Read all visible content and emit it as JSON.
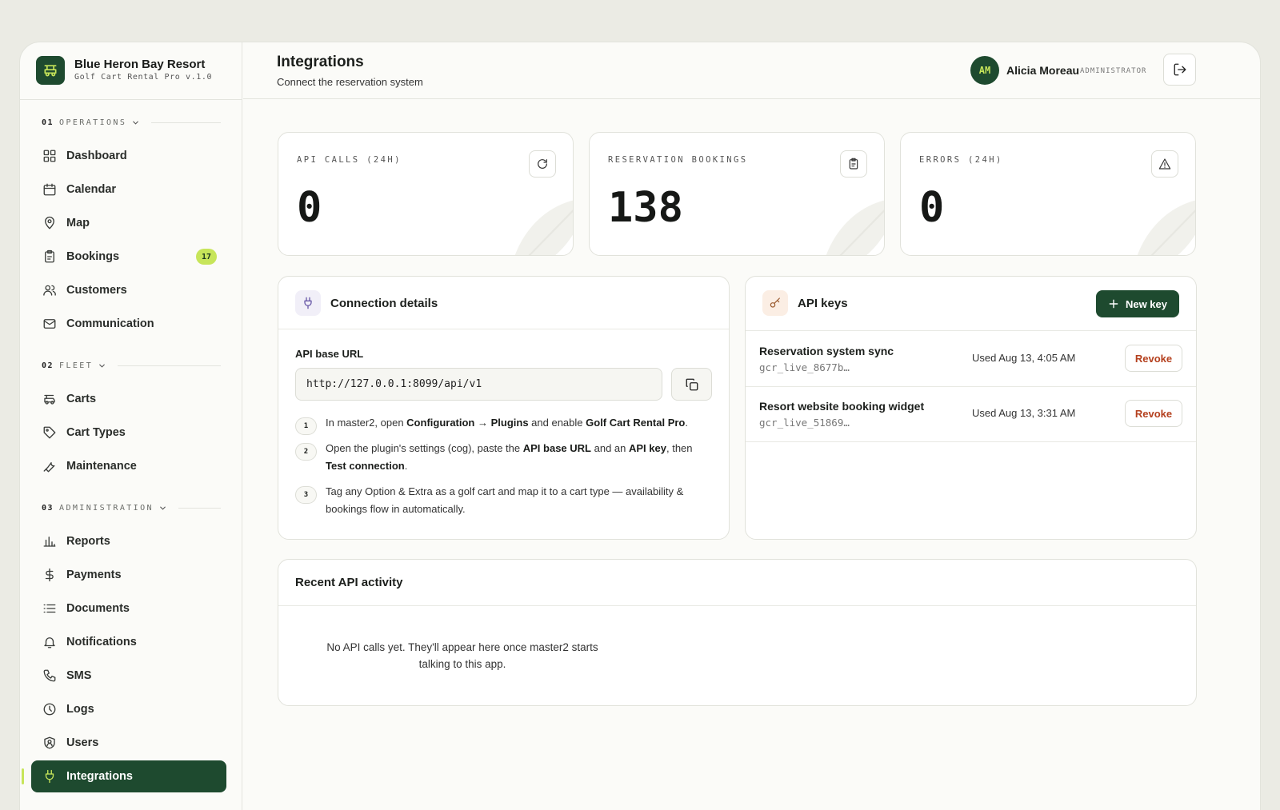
{
  "brand": {
    "name": "Blue Heron Bay Resort",
    "subtitle": "Golf Cart Rental Pro v.1.0"
  },
  "sidebar": {
    "sections": [
      {
        "num": "01",
        "label": "OPERATIONS"
      },
      {
        "num": "02",
        "label": "FLEET"
      },
      {
        "num": "03",
        "label": "ADMINISTRATION"
      }
    ],
    "items": [
      {
        "label": "Dashboard",
        "icon": "dashboard-icon"
      },
      {
        "label": "Calendar",
        "icon": "calendar-icon"
      },
      {
        "label": "Map",
        "icon": "map-pin-icon"
      },
      {
        "label": "Bookings",
        "icon": "clipboard-icon",
        "badge": "17"
      },
      {
        "label": "Customers",
        "icon": "users-icon"
      },
      {
        "label": "Communication",
        "icon": "mail-icon"
      },
      {
        "label": "Carts",
        "icon": "golf-cart-icon"
      },
      {
        "label": "Cart Types",
        "icon": "tag-icon"
      },
      {
        "label": "Maintenance",
        "icon": "wrench-icon"
      },
      {
        "label": "Reports",
        "icon": "bar-chart-icon"
      },
      {
        "label": "Payments",
        "icon": "dollar-icon"
      },
      {
        "label": "Documents",
        "icon": "list-icon"
      },
      {
        "label": "Notifications",
        "icon": "bell-icon"
      },
      {
        "label": "SMS",
        "icon": "phone-icon"
      },
      {
        "label": "Logs",
        "icon": "clock-icon"
      },
      {
        "label": "Users",
        "icon": "shield-user-icon"
      },
      {
        "label": "Integrations",
        "icon": "plug-icon",
        "active": true
      }
    ]
  },
  "header": {
    "title": "Integrations",
    "subtitle": "Connect the reservation system"
  },
  "user": {
    "initials": "AM",
    "name": "Alicia Moreau",
    "role": "ADMINISTRATOR"
  },
  "stats": [
    {
      "label": "API CALLS (24H)",
      "value": "0",
      "icon": "refresh-icon"
    },
    {
      "label": "RESERVATION BOOKINGS",
      "value": "138",
      "icon": "clipboard-icon"
    },
    {
      "label": "ERRORS (24H)",
      "value": "0",
      "icon": "warning-icon"
    }
  ],
  "connection": {
    "title": "Connection details",
    "url_label": "API base URL",
    "url": "http://127.0.0.1:8099/api/v1",
    "steps": [
      {
        "num": "1",
        "parts": [
          {
            "t": "In master2, open "
          },
          {
            "t": "Configuration → Plugins",
            "b": true
          },
          {
            "t": " and enable "
          },
          {
            "t": "Golf Cart Rental Pro",
            "b": true
          },
          {
            "t": "."
          }
        ]
      },
      {
        "num": "2",
        "parts": [
          {
            "t": "Open the plugin's settings (cog), paste the "
          },
          {
            "t": "API base URL",
            "b": true
          },
          {
            "t": " and an "
          },
          {
            "t": "API key",
            "b": true
          },
          {
            "t": ", then "
          },
          {
            "t": "Test connection",
            "b": true
          },
          {
            "t": "."
          }
        ]
      },
      {
        "num": "3",
        "parts": [
          {
            "t": "Tag any Option & Extra as a golf cart and map it to a cart type — availability & bookings flow in automatically."
          }
        ]
      }
    ]
  },
  "api_keys": {
    "title": "API keys",
    "new_label": "New key",
    "revoke_label": "Revoke",
    "keys": [
      {
        "name": "Reservation system sync",
        "id": "gcr_live_8677b…",
        "used": "Used Aug 13, 4:05 AM"
      },
      {
        "name": "Resort website booking widget",
        "id": "gcr_live_51869…",
        "used": "Used Aug 13, 3:31 AM"
      }
    ]
  },
  "activity": {
    "title": "Recent API activity",
    "empty": "No API calls yet. They'll appear here once master2 starts talking to this app."
  },
  "colors": {
    "brand": "#1e4a2f",
    "accent": "#c7e55a",
    "danger": "#b4401e"
  }
}
